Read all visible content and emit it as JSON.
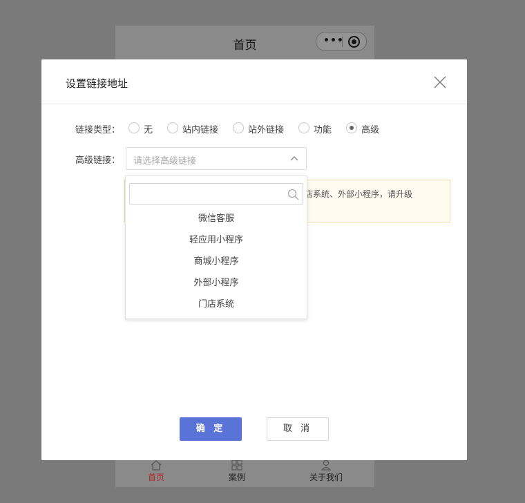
{
  "phone": {
    "title": "首页",
    "capsule_dots": "•••",
    "tabs": [
      {
        "label": "首页",
        "icon": "home-icon",
        "active": true
      },
      {
        "label": "案例",
        "icon": "grid-icon",
        "active": false
      },
      {
        "label": "关于我们",
        "icon": "user-icon",
        "active": false
      }
    ]
  },
  "modal": {
    "title": "设置链接地址",
    "link_type_label": "链接类型：",
    "link_types": [
      {
        "label": "无",
        "checked": false
      },
      {
        "label": "站内链接",
        "checked": false
      },
      {
        "label": "站外链接",
        "checked": false
      },
      {
        "label": "功能",
        "checked": false
      },
      {
        "label": "高级",
        "checked": true
      }
    ],
    "advanced_label": "高级链接：",
    "select_placeholder": "请选择高级链接",
    "notice_text": "程序、门店系统、外部小程序，请升级",
    "search_placeholder": "",
    "options": [
      "微信客服",
      "轻应用小程序",
      "商城小程序",
      "外部小程序",
      "门店系统"
    ],
    "ok_label": "确 定",
    "cancel_label": "取 消"
  },
  "colors": {
    "primary": "#5a73d6",
    "active_tab": "#b02a2a",
    "overlay": "#7a7a7a",
    "notice_bg": "#fffbf0",
    "notice_border": "#f5dfa8"
  }
}
